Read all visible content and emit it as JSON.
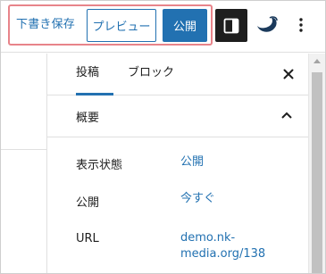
{
  "toolbar": {
    "draft_label": "下書き保存",
    "preview_label": "プレビュー",
    "publish_label": "公開"
  },
  "sidebar": {
    "tabs": [
      {
        "label": "投稿",
        "active": true
      },
      {
        "label": "ブロック",
        "active": false
      }
    ],
    "panel": {
      "title": "概要",
      "rows": [
        {
          "label": "表示状態",
          "value": "公開"
        },
        {
          "label": "公開",
          "value": "今すぐ"
        },
        {
          "label": "URL",
          "value_line1": "demo.nk-",
          "value_line2": "media.org/138"
        }
      ]
    }
  },
  "colors": {
    "accent": "#2271b1",
    "highlight_border": "#e8848a",
    "dark_button": "#1e1e1e"
  },
  "icons": [
    "settings-sidebar-icon",
    "site-logo-icon",
    "more-options-icon",
    "close-icon",
    "chevron-up-icon"
  ]
}
